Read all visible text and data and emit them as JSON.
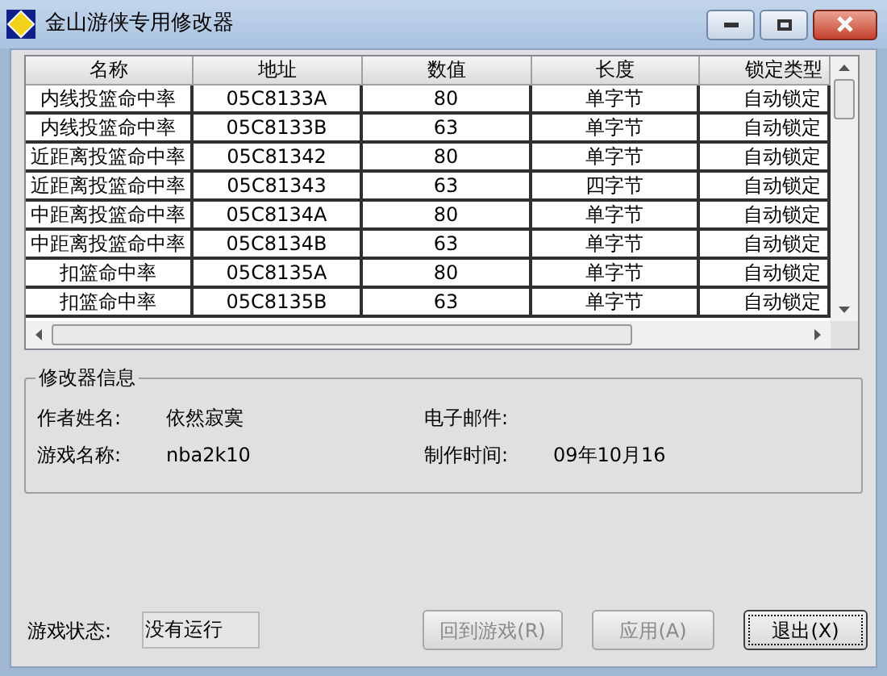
{
  "window": {
    "title": "金山游侠专用修改器"
  },
  "table": {
    "columns": [
      "名称",
      "地址",
      "数值",
      "长度",
      "锁定类型"
    ],
    "rows": [
      [
        "内线投篮命中率",
        "05C8133A",
        "80",
        "单字节",
        "自动锁定"
      ],
      [
        "内线投篮命中率",
        "05C8133B",
        "63",
        "单字节",
        "自动锁定"
      ],
      [
        "近距离投篮命中率",
        "05C81342",
        "80",
        "单字节",
        "自动锁定"
      ],
      [
        "近距离投篮命中率",
        "05C81343",
        "63",
        "四字节",
        "自动锁定"
      ],
      [
        "中距离投篮命中率",
        "05C8134A",
        "80",
        "单字节",
        "自动锁定"
      ],
      [
        "中距离投篮命中率",
        "05C8134B",
        "63",
        "单字节",
        "自动锁定"
      ],
      [
        "扣篮命中率",
        "05C8135A",
        "80",
        "单字节",
        "自动锁定"
      ],
      [
        "扣篮命中率",
        "05C8135B",
        "63",
        "单字节",
        "自动锁定"
      ]
    ]
  },
  "info": {
    "title": "修改器信息",
    "fields": [
      {
        "label": "作者姓名:",
        "value": "依然寂寞"
      },
      {
        "label": "电子邮件:"
      },
      {
        "label": "游戏名称:",
        "value": "nba2k10"
      },
      {
        "label": "制作时间:",
        "value": "09年10月16"
      }
    ]
  },
  "status": {
    "label": "游戏状态:",
    "value": "没有运行"
  },
  "buttons": [
    {
      "label": "回到游戏(R)",
      "disabled": true,
      "focused": false
    },
    {
      "label": "应用(A)",
      "disabled": true,
      "focused": false
    },
    {
      "label": "退出(X)",
      "disabled": false,
      "focused": true
    }
  ]
}
